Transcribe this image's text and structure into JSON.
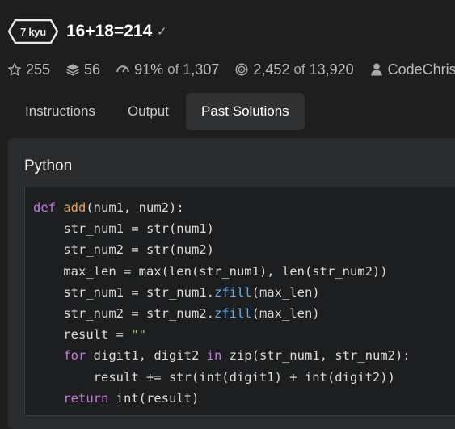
{
  "header": {
    "kyu": "7 kyu",
    "title": "16+18=214",
    "check_icon": "check-icon"
  },
  "stats": {
    "stars": "255",
    "collections": "56",
    "satisfaction": "91%",
    "satisfaction_of": "of",
    "satisfaction_total": "1,307",
    "completed": "2,452",
    "completed_of": "of",
    "completed_total": "13,920",
    "author": "CodeChrisB"
  },
  "tabs": [
    {
      "label": "Instructions",
      "active": false
    },
    {
      "label": "Output",
      "active": false
    },
    {
      "label": "Past Solutions",
      "active": true
    }
  ],
  "solution": {
    "language": "Python",
    "code_lines": [
      "def add(num1, num2):",
      "    str_num1 = str(num1)",
      "    str_num2 = str(num2)",
      "    max_len = max(len(str_num1), len(str_num2))",
      "    str_num1 = str_num1.zfill(max_len)",
      "    str_num2 = str_num2.zfill(max_len)",
      "    result = \"\"",
      "    for digit1, digit2 in zip(str_num1, str_num2):",
      "        result += str(int(digit1) + int(digit2))",
      "    return int(result)"
    ]
  },
  "colors": {
    "background": "#1e1e1e",
    "panel": "#2a2b2d",
    "code_background": "#1d1e20",
    "keyword": "#c678dd",
    "function_name": "#e5a15a",
    "string": "#98c379",
    "method": "#61afef"
  }
}
